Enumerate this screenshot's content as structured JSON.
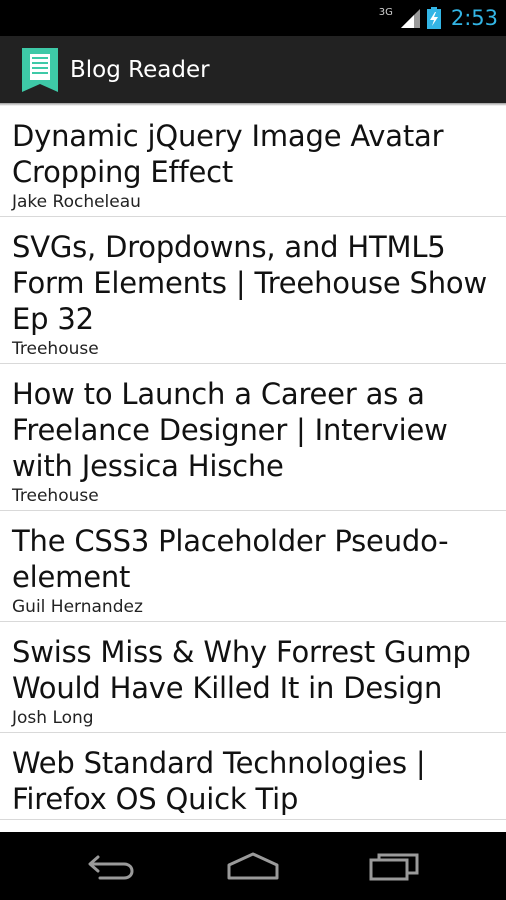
{
  "status_bar": {
    "network": "3G",
    "time": "2:53"
  },
  "action_bar": {
    "title": "Blog Reader",
    "icon": "document-icon"
  },
  "posts": [
    {
      "title": "Dynamic jQuery Image Avatar Cropping Effect",
      "author": "Jake Rocheleau"
    },
    {
      "title": "SVGs, Dropdowns, and HTML5 Form Elements | Treehouse Show Ep 32",
      "author": "Treehouse"
    },
    {
      "title": "How to Launch a Career as a Freelance Designer | Interview with Jessica Hische",
      "author": "Treehouse"
    },
    {
      "title": "The CSS3 Placeholder Pseudo-element",
      "author": "Guil Hernandez"
    },
    {
      "title": "Swiss Miss & Why Forrest Gump Would Have Killed It in Design",
      "author": "Josh Long"
    },
    {
      "title": "Web Standard Technologies | Firefox OS Quick Tip",
      "author": ""
    }
  ],
  "nav_bar": {
    "back_icon": "back-icon",
    "home_icon": "home-icon",
    "recents_icon": "recent-apps-icon"
  },
  "colors": {
    "status_time": "#33b5e5",
    "action_bar_bg": "#222222",
    "app_icon": "#3ec9a7"
  }
}
